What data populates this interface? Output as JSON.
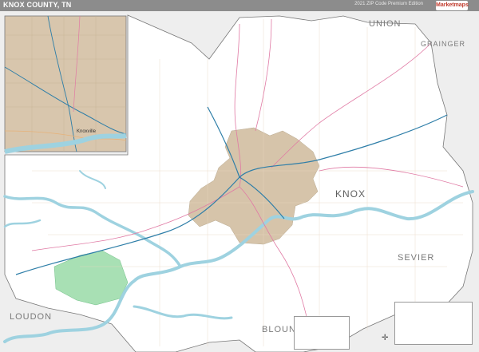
{
  "header": {
    "title": "KNOX COUNTY, TN",
    "edition": "2021 ZIP Code Premium Edition",
    "logo_text": "Marketmaps"
  },
  "labels": {
    "union": "UNION",
    "grainger": "GRAINGER",
    "knox": "KNOX",
    "sevier": "SEVIER",
    "loudon": "LOUDON",
    "blount": "BLOUN",
    "knoxville": "Knoxville"
  },
  "colors": {
    "water": "#9ed2e0",
    "urban": "#d6c4aa",
    "county": "#ffffff",
    "outside": "#eeeeee",
    "zip_highlight": "#a8e0b4",
    "interstate": "#2e7ea8",
    "highway": "#e07aa4",
    "road": "#e6b27a"
  },
  "icons": {
    "compass": "compass-rose-icon",
    "logo": "marketmaps-logo-icon"
  }
}
